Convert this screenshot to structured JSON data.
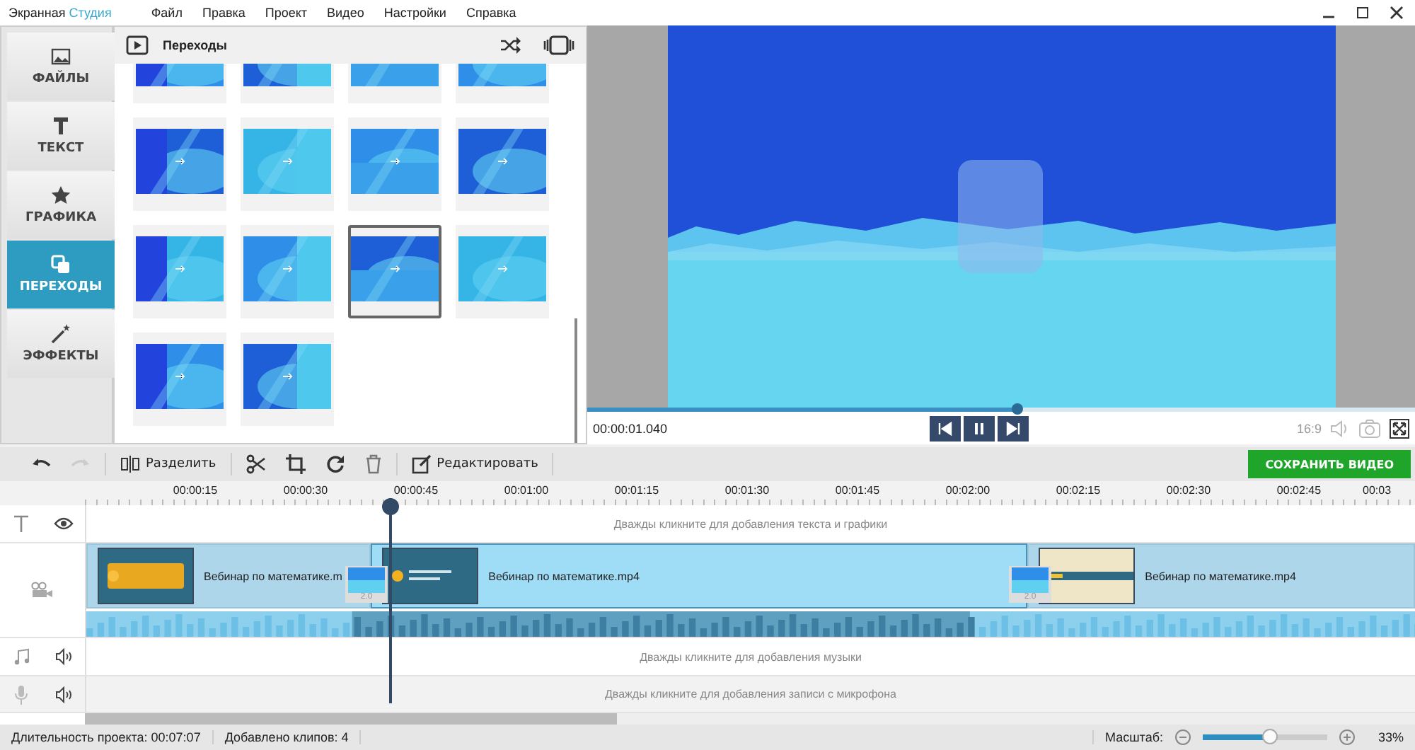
{
  "app_title": {
    "name": "Экранная",
    "accent": "Студия"
  },
  "menu": [
    "Файл",
    "Правка",
    "Проект",
    "Видео",
    "Настройки",
    "Справка"
  ],
  "sidebar": [
    {
      "label": "ФАЙЛЫ",
      "selected": false
    },
    {
      "label": "ТЕКСТ",
      "selected": false
    },
    {
      "label": "ГРАФИКА",
      "selected": false
    },
    {
      "label": "ПЕРЕХОДЫ",
      "selected": true
    },
    {
      "label": "ЭФФЕКТЫ",
      "selected": false
    }
  ],
  "panel": {
    "title": "Переходы",
    "thumbnails": [
      {
        "selected": false
      },
      {
        "selected": false
      },
      {
        "selected": false
      },
      {
        "selected": false
      },
      {
        "selected": false
      },
      {
        "selected": false
      },
      {
        "selected": false
      },
      {
        "selected": false
      },
      {
        "selected": false
      },
      {
        "selected": false
      },
      {
        "selected": true
      },
      {
        "selected": false
      },
      {
        "selected": false
      },
      {
        "selected": false
      }
    ]
  },
  "player": {
    "progress": {
      "level": 0.52
    },
    "time": "00:00:01.040",
    "aspect": "16:9"
  },
  "toolbar": {
    "split": "Разделить",
    "edit": "Редактировать",
    "redo_disabled": true
  },
  "save_button": "СОХРАНИТЬ ВИДЕО",
  "ruler": [
    "00:00:15",
    "00:00:30",
    "00:00:45",
    "00:01:00",
    "00:01:15",
    "00:01:30",
    "00:01:45",
    "00:02:00",
    "00:02:15",
    "00:02:30",
    "00:02:45",
    "00:03"
  ],
  "tracks": {
    "text_hint": "Дважды кликните для добавления текста и графики",
    "clips": [
      {
        "name": "Вебинар по математике.m",
        "selected": false
      },
      {
        "name": "Вебинар по математике.mp4",
        "selected": true
      },
      {
        "name": "Вебинар по математике.mp4",
        "selected": false
      }
    ],
    "transitions": [
      "2.0",
      "2.0"
    ],
    "music_hint": "Дважды кликните для добавления музыки",
    "mic_hint": "Дважды кликните для добавления записи с микрофона"
  },
  "status_bar": {
    "duration_label": "Длительность проекта:",
    "duration": "00:07:07",
    "clips": "Добавлено клипов: 4",
    "zoom_label": "Масштаб:",
    "zoom": {
      "level": 0.55
    },
    "zoom_value": "33%"
  }
}
